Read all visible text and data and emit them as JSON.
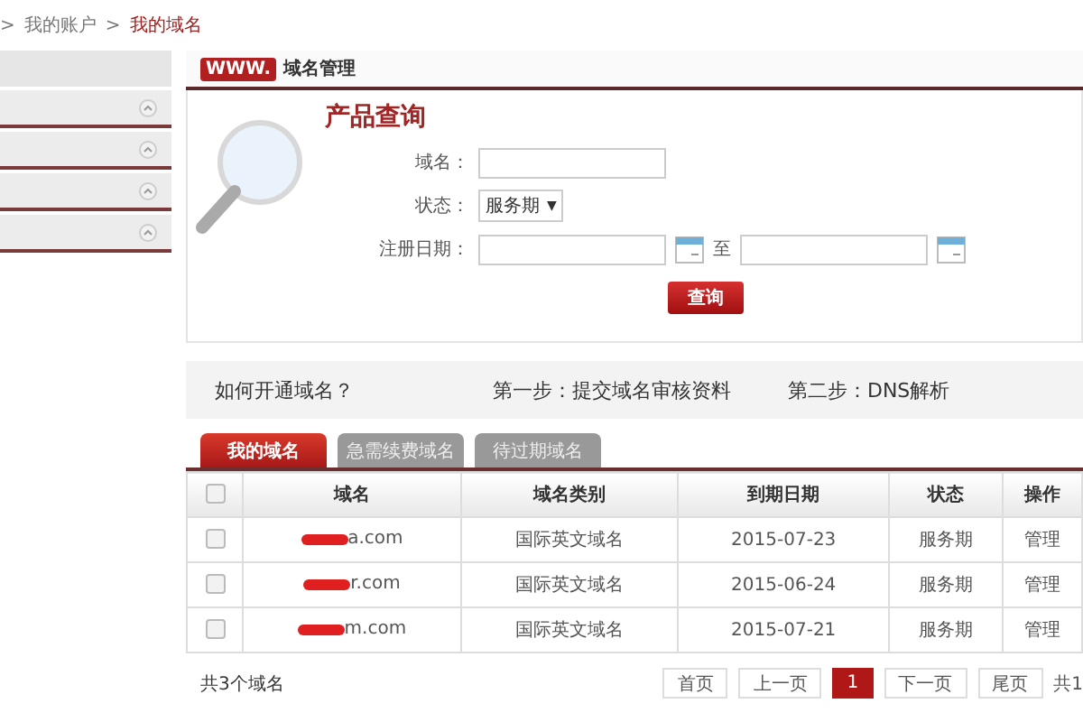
{
  "breadcrumb": [
    {
      "separator": ">",
      "label": "我的账户",
      "current": false
    },
    {
      "separator": ">",
      "label": "我的域名",
      "current": true
    }
  ],
  "panel": {
    "badge": "WWW.",
    "title": "域名管理"
  },
  "search": {
    "heading": "产品查询",
    "fields": [
      {
        "kind": "text",
        "label": "域名："
      },
      {
        "kind": "select",
        "label": "状态：",
        "value": "服务期",
        "caret": "▼"
      },
      {
        "kind": "daterange",
        "label": "注册日期：",
        "between": "至"
      }
    ],
    "button": "查询"
  },
  "guide": {
    "question": "如何开通域名？",
    "step_1": "第一步：提交域名审核资料",
    "step_2": "第二步：DNS解析"
  },
  "tabs": [
    {
      "label": "我的域名",
      "selected": true
    },
    {
      "label": "急需续费域名",
      "selected": false
    },
    {
      "label": "待过期域名",
      "selected": false
    }
  ],
  "table": {
    "select_all_checked": false,
    "columns": [
      "域名",
      "域名类别",
      "到期日期",
      "状态",
      "操作"
    ],
    "rows": [
      {
        "checked": false,
        "domain": "a.com",
        "category": "国际英文域名",
        "expiry": "2015-07-23",
        "status": "服务期",
        "action": "管理"
      },
      {
        "checked": false,
        "domain": "r.com",
        "category": "国际英文域名",
        "expiry": "2015-06-24",
        "status": "服务期",
        "action": "管理"
      },
      {
        "checked": false,
        "domain": "m.com",
        "category": "国际英文域名",
        "expiry": "2015-07-21",
        "status": "服务期",
        "action": "管理"
      }
    ]
  },
  "footer": {
    "total": "共3个域名",
    "pages": [
      {
        "label": "首页",
        "selected": false
      },
      {
        "label": "上一页",
        "selected": false
      },
      {
        "label": "1",
        "selected": true
      },
      {
        "label": "下一页",
        "selected": false
      },
      {
        "label": "尾页",
        "selected": false
      }
    ],
    "page_count": "共1"
  }
}
